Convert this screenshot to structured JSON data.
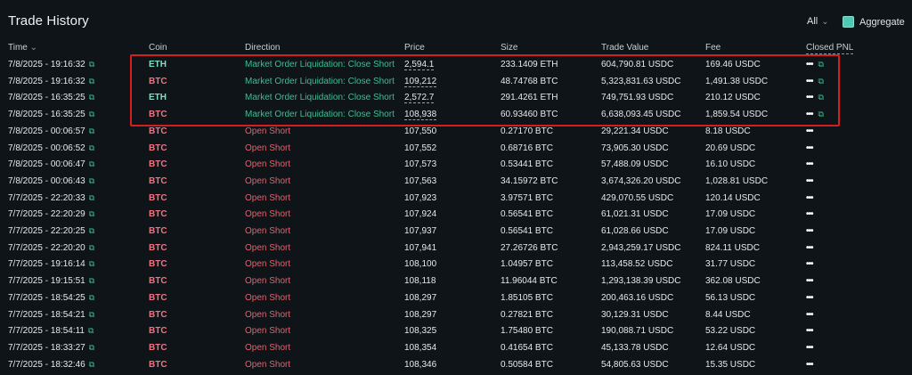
{
  "title": "Trade History",
  "filter": {
    "value": "All"
  },
  "aggregate": {
    "label": "Aggregate",
    "checked": true
  },
  "headers": {
    "time": "Time",
    "coin": "Coin",
    "direction": "Direction",
    "price": "Price",
    "size": "Size",
    "value": "Trade Value",
    "fee": "Fee",
    "pnl": "Closed PNL"
  },
  "rows": [
    {
      "time": "7/8/2025 - 19:16:32",
      "coin": "ETH",
      "direction": "Market Order Liquidation: Close Short",
      "price": "2,594.1",
      "size": "233.1409 ETH",
      "value": "604,790.81 USDC",
      "fee": "169.46 USDC",
      "pnl": "•••"
    },
    {
      "time": "7/8/2025 - 19:16:32",
      "coin": "BTC",
      "direction": "Market Order Liquidation: Close Short",
      "price": "109,212",
      "size": "48.74768 BTC",
      "value": "5,323,831.63 USDC",
      "fee": "1,491.38 USDC",
      "pnl": "•••"
    },
    {
      "time": "7/8/2025 - 16:35:25",
      "coin": "ETH",
      "direction": "Market Order Liquidation: Close Short",
      "price": "2,572.7",
      "size": "291.4261 ETH",
      "value": "749,751.93 USDC",
      "fee": "210.12 USDC",
      "pnl": "•••"
    },
    {
      "time": "7/8/2025 - 16:35:25",
      "coin": "BTC",
      "direction": "Market Order Liquidation: Close Short",
      "price": "108,938",
      "size": "60.93460 BTC",
      "value": "6,638,093.45 USDC",
      "fee": "1,859.54 USDC",
      "pnl": "•••"
    },
    {
      "time": "7/8/2025 - 00:06:57",
      "coin": "BTC",
      "direction": "Open Short",
      "price": "107,550",
      "size": "0.27170 BTC",
      "value": "29,221.34 USDC",
      "fee": "8.18 USDC",
      "pnl": "•••"
    },
    {
      "time": "7/8/2025 - 00:06:52",
      "coin": "BTC",
      "direction": "Open Short",
      "price": "107,552",
      "size": "0.68716 BTC",
      "value": "73,905.30 USDC",
      "fee": "20.69 USDC",
      "pnl": "•••"
    },
    {
      "time": "7/8/2025 - 00:06:47",
      "coin": "BTC",
      "direction": "Open Short",
      "price": "107,573",
      "size": "0.53441 BTC",
      "value": "57,488.09 USDC",
      "fee": "16.10 USDC",
      "pnl": "•••"
    },
    {
      "time": "7/8/2025 - 00:06:43",
      "coin": "BTC",
      "direction": "Open Short",
      "price": "107,563",
      "size": "34.15972 BTC",
      "value": "3,674,326.20 USDC",
      "fee": "1,028.81 USDC",
      "pnl": "•••"
    },
    {
      "time": "7/7/2025 - 22:20:33",
      "coin": "BTC",
      "direction": "Open Short",
      "price": "107,923",
      "size": "3.97571 BTC",
      "value": "429,070.55 USDC",
      "fee": "120.14 USDC",
      "pnl": "•••"
    },
    {
      "time": "7/7/2025 - 22:20:29",
      "coin": "BTC",
      "direction": "Open Short",
      "price": "107,924",
      "size": "0.56541 BTC",
      "value": "61,021.31 USDC",
      "fee": "17.09 USDC",
      "pnl": "•••"
    },
    {
      "time": "7/7/2025 - 22:20:25",
      "coin": "BTC",
      "direction": "Open Short",
      "price": "107,937",
      "size": "0.56541 BTC",
      "value": "61,028.66 USDC",
      "fee": "17.09 USDC",
      "pnl": "•••"
    },
    {
      "time": "7/7/2025 - 22:20:20",
      "coin": "BTC",
      "direction": "Open Short",
      "price": "107,941",
      "size": "27.26726 BTC",
      "value": "2,943,259.17 USDC",
      "fee": "824.11 USDC",
      "pnl": "•••"
    },
    {
      "time": "7/7/2025 - 19:16:14",
      "coin": "BTC",
      "direction": "Open Short",
      "price": "108,100",
      "size": "1.04957 BTC",
      "value": "113,458.52 USDC",
      "fee": "31.77 USDC",
      "pnl": "•••"
    },
    {
      "time": "7/7/2025 - 19:15:51",
      "coin": "BTC",
      "direction": "Open Short",
      "price": "108,118",
      "size": "11.96044 BTC",
      "value": "1,293,138.39 USDC",
      "fee": "362.08 USDC",
      "pnl": "•••"
    },
    {
      "time": "7/7/2025 - 18:54:25",
      "coin": "BTC",
      "direction": "Open Short",
      "price": "108,297",
      "size": "1.85105 BTC",
      "value": "200,463.16 USDC",
      "fee": "56.13 USDC",
      "pnl": "•••"
    },
    {
      "time": "7/7/2025 - 18:54:21",
      "coin": "BTC",
      "direction": "Open Short",
      "price": "108,297",
      "size": "0.27821 BTC",
      "value": "30,129.31 USDC",
      "fee": "8.44 USDC",
      "pnl": "•••"
    },
    {
      "time": "7/7/2025 - 18:54:11",
      "coin": "BTC",
      "direction": "Open Short",
      "price": "108,325",
      "size": "1.75480 BTC",
      "value": "190,088.71 USDC",
      "fee": "53.22 USDC",
      "pnl": "•••"
    },
    {
      "time": "7/7/2025 - 18:33:27",
      "coin": "BTC",
      "direction": "Open Short",
      "price": "108,354",
      "size": "0.41654 BTC",
      "value": "45,133.78 USDC",
      "fee": "12.64 USDC",
      "pnl": "•••"
    },
    {
      "time": "7/7/2025 - 18:32:46",
      "coin": "BTC",
      "direction": "Open Short",
      "price": "108,346",
      "size": "0.50584 BTC",
      "value": "54,805.63 USDC",
      "fee": "15.35 USDC",
      "pnl": "•••"
    }
  ],
  "colors": {
    "background": "#0e1417",
    "buy_green": "#3fbf95",
    "sell_red": "#e8606e",
    "highlight_box": "#d11f22"
  }
}
